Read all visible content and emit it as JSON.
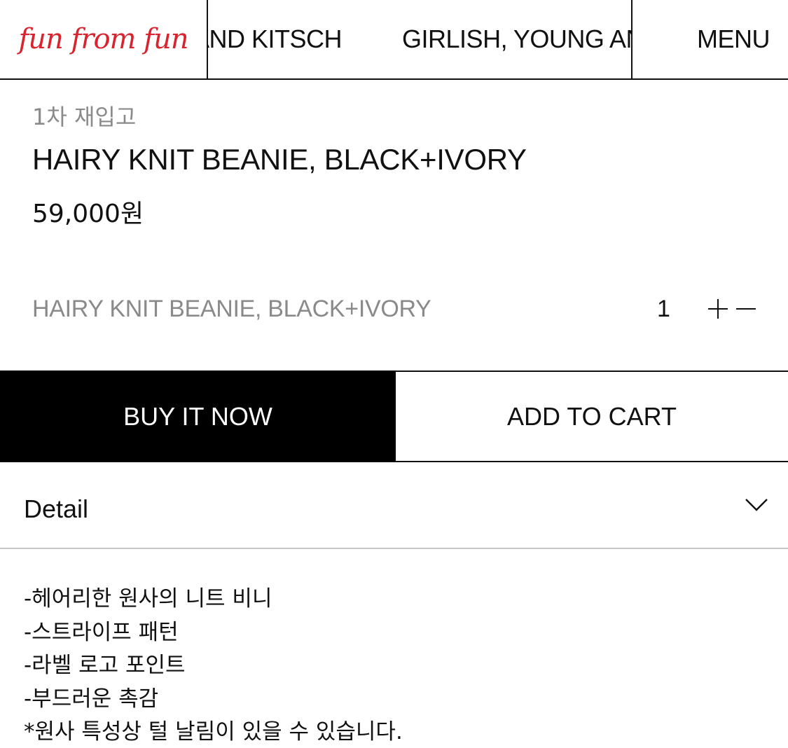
{
  "header": {
    "logo_text": "fun from fun",
    "marquee_items": [
      "AND KITSCH",
      "GIRLISH, YOUNG AND KITSCH"
    ],
    "menu_label": "MENU"
  },
  "product": {
    "restock_label": "1차 재입고",
    "title": "HAIRY KNIT BEANIE, BLACK+IVORY",
    "price": "59,000원"
  },
  "option": {
    "name": "HAIRY KNIT BEANIE, BLACK+IVORY",
    "quantity": "1"
  },
  "actions": {
    "buy_now_label": "BUY IT NOW",
    "add_to_cart_label": "ADD TO CART"
  },
  "detail": {
    "title": "Detail",
    "lines": [
      "-헤어리한 원사의 니트 비니",
      "-스트라이프 패턴",
      "-라벨 로고 포인트",
      "-부드러운 촉감",
      "*원사 특성상 털 날림이 있을 수 있습니다."
    ]
  },
  "colors": {
    "logo_red": "#d8242f",
    "buy_button_bg": "#000000",
    "muted_text": "#8a8a8a"
  },
  "icons": {
    "plus": "plus-icon",
    "minus": "minus-icon",
    "chevron": "chevron-down-icon"
  }
}
